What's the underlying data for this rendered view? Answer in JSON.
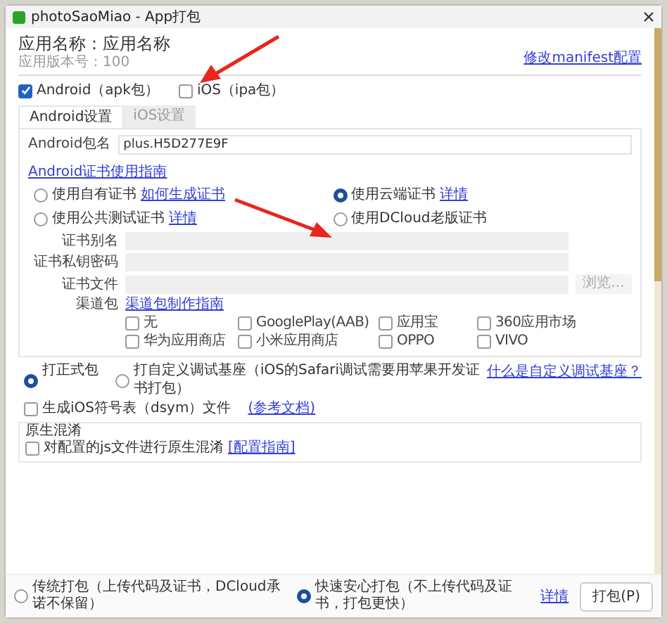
{
  "window": {
    "title": "photoSaoMiao - App打包"
  },
  "header": {
    "app_name": "应用名称：应用名称",
    "version": "应用版本号：100",
    "manifest_link": "修改manifest配置"
  },
  "platforms": [
    {
      "label": "Android（apk包）",
      "checked": true
    },
    {
      "label": "iOS（ipa包）",
      "checked": false
    }
  ],
  "tabs": [
    {
      "label": "Android设置",
      "selected": true
    },
    {
      "label": "iOS设置",
      "selected": false
    }
  ],
  "package_field": {
    "label": "Android包名",
    "value": "plus.H5D277E9F"
  },
  "cert_guide_link": "Android证书使用指南",
  "cert_options": [
    {
      "label": "使用自有证书",
      "link": "如何生成证书",
      "selected": false
    },
    {
      "label": "使用云端证书",
      "link": "详情",
      "selected": true
    },
    {
      "label": "使用公共测试证书",
      "link": "详情",
      "selected": false
    },
    {
      "label": "使用DCloud老版证书",
      "selected": false
    }
  ],
  "cert_fields": [
    {
      "label": "证书别名"
    },
    {
      "label": "证书私钥密码"
    },
    {
      "label": "证书文件",
      "button": "浏览..."
    }
  ],
  "channels": {
    "label": "渠道包",
    "guide_link": "渠道包制作指南",
    "items": [
      {
        "label": "无",
        "checked": false
      },
      {
        "label": "GooglePlay(AAB)",
        "checked": false
      },
      {
        "label": "应用宝",
        "checked": false
      },
      {
        "label": "360应用市场",
        "checked": false
      },
      {
        "label": "华为应用商店",
        "checked": false
      },
      {
        "label": "小米应用商店",
        "checked": false
      },
      {
        "label": "OPPO",
        "checked": false
      },
      {
        "label": "VIVO",
        "checked": false
      }
    ]
  },
  "build_types": [
    {
      "label": "打正式包",
      "selected": true
    },
    {
      "label": "打自定义调试基座（iOS的Safari调试需要用苹果开发证书打包）",
      "link": "什么是自定义调试基座？",
      "selected": false
    }
  ],
  "dsym": {
    "label": "生成iOS符号表（dsym）文件",
    "link": "(参考文档)",
    "checked": false
  },
  "obfuscation": {
    "legend": "原生混淆",
    "label": "对配置的js文件进行原生混淆",
    "link": "[配置指南]",
    "checked": false
  },
  "footer": {
    "modes": [
      {
        "label": "传统打包（上传代码及证书，DCloud承诺不保留）",
        "selected": false
      },
      {
        "label": "快速安心打包（不上传代码及证书，打包更快）",
        "link": "详情",
        "selected": true
      }
    ],
    "button": "打包(P)"
  }
}
